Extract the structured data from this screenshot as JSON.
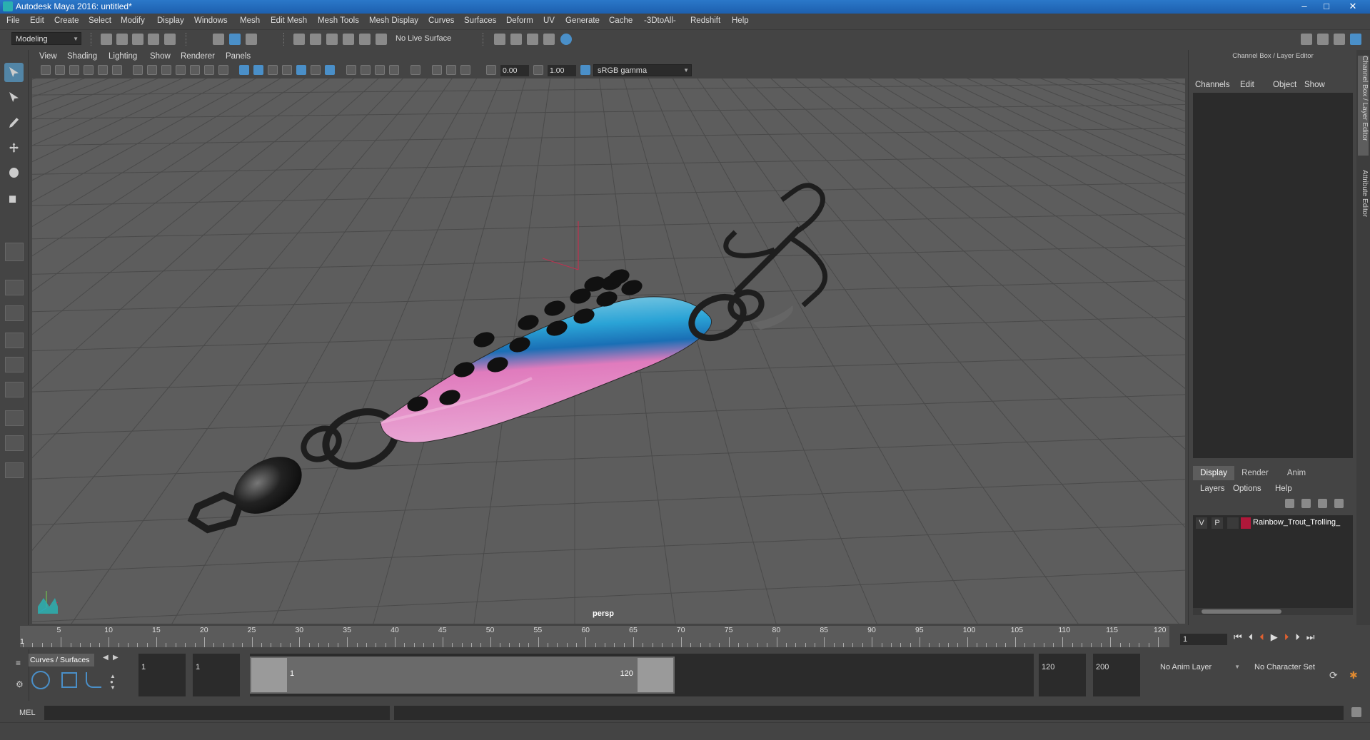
{
  "window": {
    "title": "Autodesk Maya 2016: untitled*",
    "minimize": "–",
    "maximize": "□",
    "close": "✕"
  },
  "menubar": [
    "File",
    "Edit",
    "Create",
    "Select",
    "Modify",
    "Display",
    "Windows",
    "Mesh",
    "Edit Mesh",
    "Mesh Tools",
    "Mesh Display",
    "Curves",
    "Surfaces",
    "Deform",
    "UV",
    "Generate",
    "Cache",
    "-3DtoAll-",
    "Redshift",
    "Help"
  ],
  "statusline": {
    "mode": "Modeling",
    "live_surface": "No Live Surface"
  },
  "viewport": {
    "menu": [
      "View",
      "Shading",
      "Lighting",
      "Show",
      "Renderer",
      "Panels"
    ],
    "exposure": "0.00",
    "gamma": "1.00",
    "color_space": "sRGB gamma",
    "camera": "persp"
  },
  "right_panel": {
    "header": "Channel Box / Layer Editor",
    "channel_menu": [
      "Channels",
      "Edit",
      "Object",
      "Show"
    ],
    "tabs": [
      "Display",
      "Render",
      "Anim"
    ],
    "active_tab": "Display",
    "layer_menu": [
      "Layers",
      "Options",
      "Help"
    ],
    "layer": {
      "visible": "V",
      "playback": "P",
      "name": "Rainbow_Trout_Trolling_",
      "color": "#b0183a"
    },
    "side_tabs": [
      "Channel Box / Layer Editor",
      "Attribute Editor"
    ]
  },
  "timeslider": {
    "ticks": [
      5,
      10,
      15,
      20,
      25,
      30,
      35,
      40,
      45,
      50,
      55,
      60,
      65,
      70,
      75,
      80,
      85,
      90,
      95,
      100,
      105,
      110,
      115,
      120
    ],
    "start_label": "1",
    "range_min": 1,
    "range_max": 120,
    "current_frame": "1"
  },
  "rangebar": {
    "shelf_tab": "Curves / Surfaces",
    "start_time": "1",
    "playback_start": "1",
    "range_start_label": "1",
    "range_end_label": "120",
    "playback_end": "120",
    "end_time": "200",
    "anim_layer": "No Anim Layer",
    "character_set": "No Character Set"
  },
  "cmdline": {
    "label": "MEL"
  },
  "colors": {
    "accent": "#5285a6",
    "lure_blue": "#2aa3d6",
    "lure_pink": "#e07bbd",
    "lure_spot": "#111111"
  }
}
